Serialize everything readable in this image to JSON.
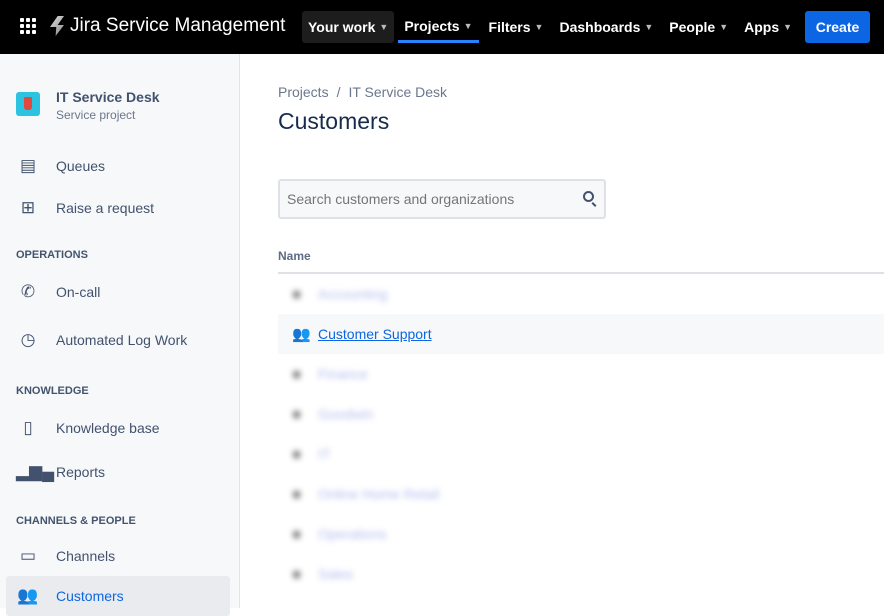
{
  "topbar": {
    "product": "Jira Service Management",
    "nav": [
      {
        "label": "Your work"
      },
      {
        "label": "Projects"
      },
      {
        "label": "Filters"
      },
      {
        "label": "Dashboards"
      },
      {
        "label": "People"
      },
      {
        "label": "Apps"
      }
    ],
    "create": "Create"
  },
  "sidebar": {
    "project_name": "IT Service Desk",
    "project_type": "Service project",
    "items": [
      {
        "label": "Queues"
      },
      {
        "label": "Raise a request"
      },
      {
        "label": "On-call"
      },
      {
        "label": "Automated Log Work"
      },
      {
        "label": "Knowledge base"
      },
      {
        "label": "Reports"
      },
      {
        "label": "Channels"
      },
      {
        "label": "Customers"
      }
    ],
    "sections": [
      "OPERATIONS",
      "KNOWLEDGE",
      "CHANNELS & PEOPLE"
    ]
  },
  "main": {
    "breadcrumb": [
      "Projects",
      "IT Service Desk"
    ],
    "title": "Customers",
    "search_placeholder": "Search customers and organizations",
    "column": "Name",
    "rows": [
      "Accounting",
      "Customer Support",
      "Finance",
      "Goodwin",
      "IT",
      "Online Home Retail",
      "Operations",
      "Sales"
    ]
  }
}
